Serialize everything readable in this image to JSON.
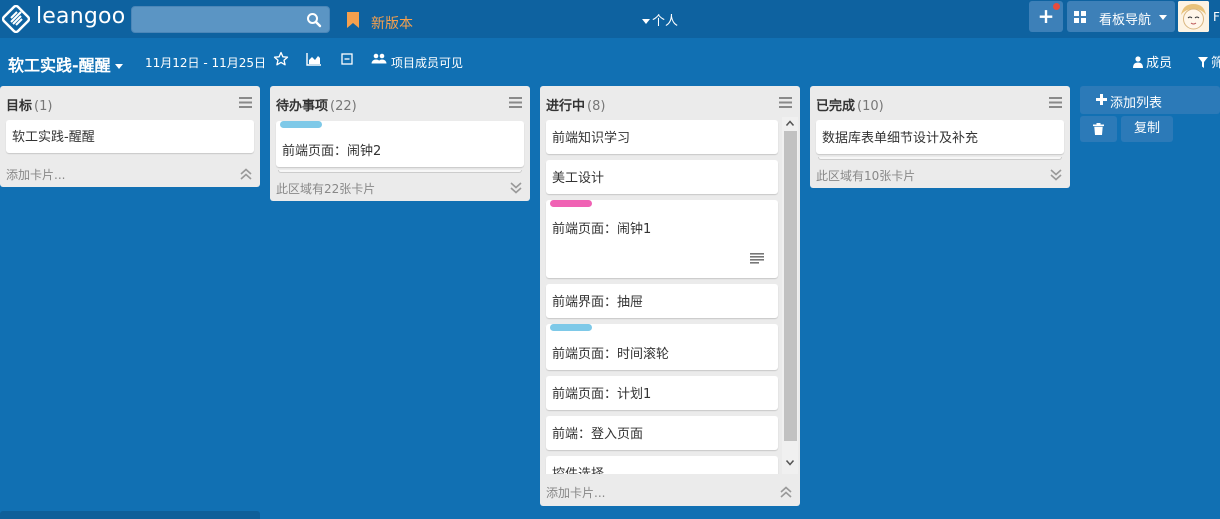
{
  "topbar": {
    "logo_text": "leangoo",
    "search_placeholder": "",
    "new_version_label": "新版本",
    "personal_label": "个人",
    "board_nav_label": "看板导航",
    "avatar_letter": "F"
  },
  "board": {
    "title": "软工实践-醒醒",
    "date_range": "11月12日 - 11月25日",
    "visible_label": "项目成员可见",
    "members_label": "成员",
    "filter_label": "筛"
  },
  "lists": [
    {
      "title": "目标",
      "count": "(1)",
      "cards": [
        {
          "title": "软工实践-醒醒"
        }
      ],
      "footer": "添加卡片..."
    },
    {
      "title": "待办事项",
      "count": "(22)",
      "cards": [
        {
          "title": "前端页面：闹钟2",
          "label_color": "#7ec9e8"
        }
      ],
      "footer": "此区域有22张卡片"
    },
    {
      "title": "进行中",
      "count": "(8)",
      "cards": [
        {
          "title": "前端知识学习"
        },
        {
          "title": "美工设计"
        },
        {
          "title": "前端页面：闹钟1",
          "label_color": "#f062b4"
        },
        {
          "title": "前端界面：抽屉"
        },
        {
          "title": "前端页面：时间滚轮",
          "label_color": "#7ec9e8"
        },
        {
          "title": "前端页面：计划1"
        },
        {
          "title": "前端：登入页面"
        },
        {
          "title": "控件选择"
        }
      ],
      "footer": "添加卡片..."
    },
    {
      "title": "已完成",
      "count": "(10)",
      "cards": [
        {
          "title": "数据库表单细节设计及补充"
        }
      ],
      "footer": "此区域有10张卡片"
    }
  ],
  "actions": {
    "add_list_label": "添加列表",
    "copy_label": "复制"
  },
  "colors": {
    "background": "#1170b3",
    "topbar": "#0e62a0",
    "new_version": "#f5a04e",
    "label_blue": "#7ec9e8",
    "label_pink": "#f062b4"
  }
}
